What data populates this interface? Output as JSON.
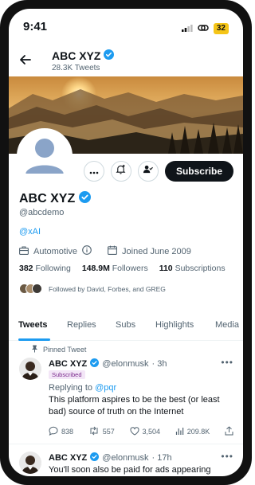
{
  "status": {
    "time": "9:41",
    "battery": "32"
  },
  "header": {
    "name": "ABC XYZ",
    "tweet_count": "28.3K Tweets"
  },
  "profile": {
    "name": "ABC XYZ",
    "handle": "@abcdemo",
    "link": "@xAI",
    "category": "Automotive",
    "joined": "Joined June 2009",
    "following_count": "382",
    "following_label": "Following",
    "followers_count": "148.9M",
    "followers_label": "Followers",
    "subscriptions_count": "110",
    "subscriptions_label": "Subscriptions",
    "followed_by": "Followed by David, Forbes, and GREG"
  },
  "actions": {
    "subscribe_label": "Subscribe"
  },
  "tabs": [
    {
      "label": "Tweets"
    },
    {
      "label": "Replies"
    },
    {
      "label": "Subs"
    },
    {
      "label": "Highlights"
    },
    {
      "label": "Media"
    }
  ],
  "tweets": [
    {
      "pinned_label": "Pinned Tweet",
      "name": "ABC XYZ",
      "handle": "@elonmusk",
      "time": "· 3h",
      "badge": "Subscribed",
      "replying_prefix": "Replying to",
      "replying_to": "@pqr",
      "text": "This platform aspires to be the best (or least bad) source of truth on the Internet",
      "comments": "838",
      "retweets": "557",
      "likes": "3,504",
      "views": "209.8K"
    },
    {
      "name": "ABC XYZ",
      "handle": "@elonmusk",
      "time": "· 17h",
      "text": "You'll soon also be paid for ads appearing"
    }
  ],
  "colors": {
    "accent": "#1d9bf0",
    "text": "#0f1419",
    "muted": "#536471",
    "verified": "#1d9bf0"
  }
}
